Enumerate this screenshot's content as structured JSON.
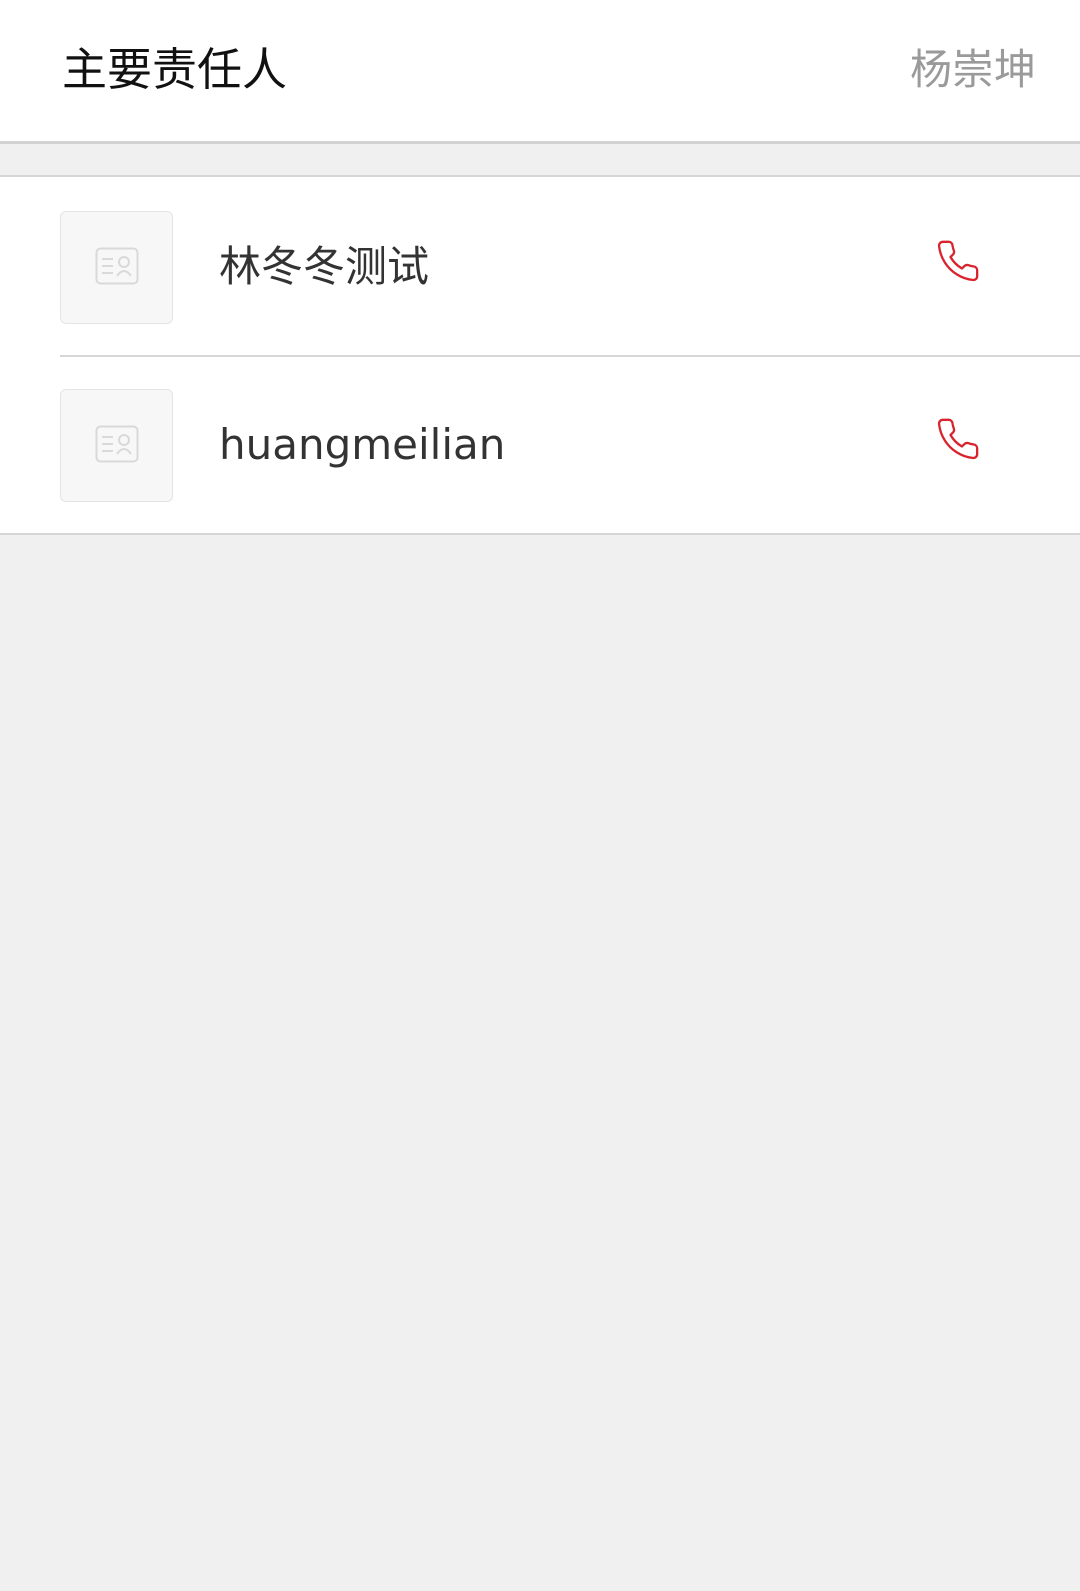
{
  "header": {
    "label": "主要责任人",
    "value": "杨崇坤"
  },
  "contacts": [
    {
      "name": "林冬冬测试",
      "avatar_icon": "contact-card-icon",
      "action_icon": "phone-icon"
    },
    {
      "name": "huangmeilian",
      "avatar_icon": "contact-card-icon",
      "action_icon": "phone-icon"
    }
  ],
  "colors": {
    "accent": "#d9232d",
    "background": "#f0f0f0",
    "surface": "#ffffff",
    "divider": "#d6d6d6",
    "muted_text": "#9a9a9a"
  }
}
